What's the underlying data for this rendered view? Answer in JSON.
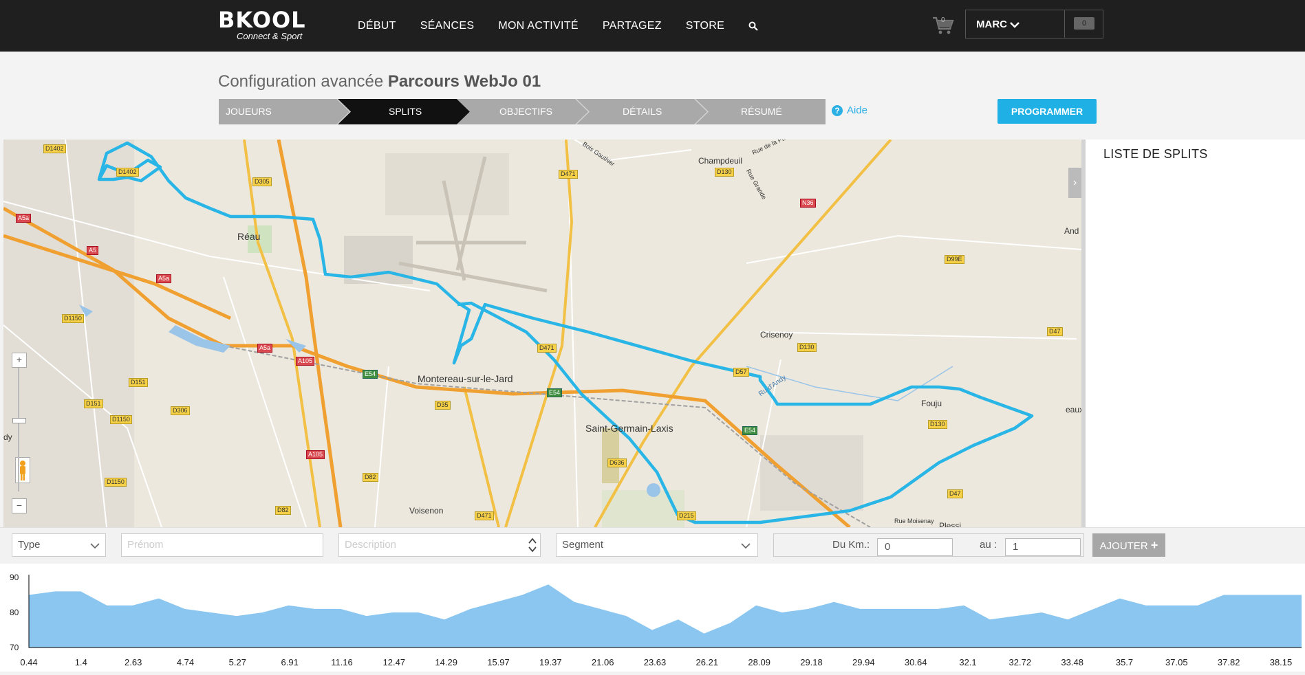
{
  "header": {
    "brand": "BKOOL",
    "tagline": "Connect & Sport",
    "nav": [
      "DÉBUT",
      "SÉANCES",
      "MON ACTIVITÉ",
      "PARTAGEZ",
      "STORE"
    ],
    "cart_count": "0",
    "user_name": "MARC",
    "user_badge": "0"
  },
  "page": {
    "title_prefix": "Configuration avancée",
    "title_name": "Parcours WebJo 01",
    "steps": [
      "JOUEURS",
      "SPLITS",
      "OBJECTIFS",
      "DÉTAILS",
      "RÉSUMÉ"
    ],
    "active_step": "SPLITS",
    "help_label": "Aide",
    "program_button": "PROGRAMMER"
  },
  "map": {
    "places": [
      "Réau",
      "Champdeuil",
      "Crisenoy",
      "Montereau-sur-le-Jard",
      "Saint-Germain-Laxis",
      "Fouju",
      "Voisenon",
      "Bois Gauthier",
      "Rue de la Paix",
      "Rue Grande",
      "Ru d'Andy",
      "Rue Moisenay",
      "And",
      "eaux",
      "dy",
      "Plessi"
    ],
    "roads": [
      "D1402",
      "D305",
      "A5a",
      "A5",
      "D1150",
      "D151",
      "D306",
      "A105",
      "D82",
      "D35",
      "E54",
      "D471",
      "D636",
      "D215",
      "D130",
      "N36",
      "D99E",
      "D47",
      "D57"
    ],
    "route_color": "#29b6e6"
  },
  "splits_panel": {
    "title": "LISTE DE SPLITS"
  },
  "toolbar": {
    "type_label": "Type",
    "name_placeholder": "Prénom",
    "description_placeholder": "Description",
    "segment_label": "Segment",
    "from_label": "Du Km.:",
    "from_value": "0",
    "to_label": "au :",
    "to_value": "1",
    "add_button": "AJOUTER"
  },
  "chart_data": {
    "type": "area",
    "title": "",
    "xlabel": "",
    "ylabel": "",
    "ylim": [
      70,
      90
    ],
    "yticks": [
      90,
      80,
      70
    ],
    "x_labels": [
      "0.44",
      "1.4",
      "2.63",
      "4.74",
      "5.27",
      "6.91",
      "11.16",
      "12.47",
      "14.29",
      "15.97",
      "19.37",
      "21.06",
      "23.63",
      "26.21",
      "28.09",
      "29.18",
      "29.94",
      "30.64",
      "32.1",
      "32.72",
      "33.48",
      "35.7",
      "37.05",
      "37.82",
      "38.15"
    ],
    "values": [
      85,
      86,
      86,
      82,
      82,
      84,
      81,
      80,
      79,
      80,
      82,
      81,
      81,
      79,
      80,
      80,
      78,
      81,
      83,
      85,
      88,
      83,
      81,
      79,
      75,
      78,
      74,
      77,
      82,
      80,
      81,
      83,
      81,
      81,
      81,
      81,
      82,
      78,
      79,
      80,
      78,
      81,
      84,
      82,
      82,
      82,
      85,
      85,
      85,
      85
    ],
    "fill_color": "#8ac6ef",
    "series": [
      {
        "values": [
          85,
          86,
          86,
          82,
          82,
          84,
          81,
          80,
          79,
          80,
          82,
          81,
          81,
          79,
          80,
          80,
          78,
          81,
          83,
          85,
          88,
          83,
          81,
          79,
          75,
          78,
          74,
          77,
          82,
          80,
          81,
          83,
          81,
          81,
          81,
          81,
          82,
          78,
          79,
          80,
          78,
          81,
          84,
          82,
          82,
          82,
          85,
          85,
          85,
          85
        ]
      }
    ]
  }
}
